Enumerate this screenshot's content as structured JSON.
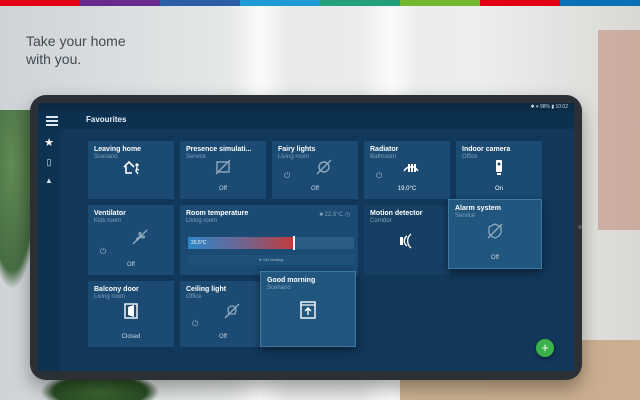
{
  "brand_colors": [
    "#e20015",
    "#6a2a8c",
    "#2a5fa8",
    "#1e9ad6",
    "#21a07a",
    "#74b72e",
    "#e20015",
    "#0a6fb4"
  ],
  "tagline": {
    "line1": "Take your home",
    "line2": "with you."
  },
  "status_bar": {
    "text": "✱ ▾ 98% ▮ 10:02"
  },
  "app_bar": {
    "title": "Favourites",
    "menu_icon": "hamburger-menu-icon"
  },
  "side_nav": [
    {
      "icon": "star-icon",
      "glyph": "★",
      "active": true
    },
    {
      "icon": "tablet-icon",
      "glyph": "▯",
      "active": false
    },
    {
      "icon": "bell-icon",
      "glyph": "▲",
      "active": false
    }
  ],
  "tiles": {
    "leaving_home": {
      "name": "Leaving home",
      "room": "Scenario",
      "icon": "leaving-home-icon"
    },
    "presence": {
      "name": "Presence simulati...",
      "room": "Service",
      "state": "Off",
      "icon": "presence-off-icon"
    },
    "fairy_lights": {
      "name": "Fairy lights",
      "room": "Living room",
      "state": "Off",
      "icon": "plug-off-icon"
    },
    "radiator": {
      "name": "Radiator",
      "room": "Bathroom",
      "state": "19.0°C",
      "icon": "radiator-icon"
    },
    "indoor_camera": {
      "name": "Indoor camera",
      "room": "Office",
      "state": "On",
      "icon": "camera-icon"
    },
    "ventilator": {
      "name": "Ventilator",
      "room": "Kids room",
      "state": "Off",
      "icon": "fan-off-icon"
    },
    "room_temperature": {
      "name": "Room temperature",
      "room": "Living room",
      "current": "20.5°C",
      "target": "22.5°C",
      "fill_fraction": 0.63,
      "action": "Set heating",
      "icon": "thermostat-icon"
    },
    "motion_detector": {
      "name": "Motion detector",
      "room": "Corridor",
      "icon": "motion-icon"
    },
    "alarm_system": {
      "name": "Alarm system",
      "room": "Service",
      "state": "Off",
      "icon": "alarm-off-icon"
    },
    "balcony_door": {
      "name": "Balcony door",
      "room": "Living room",
      "state": "Closed",
      "icon": "door-closed-icon"
    },
    "ceiling_light": {
      "name": "Ceiling light",
      "room": "Office",
      "state": "Off",
      "icon": "light-off-icon"
    },
    "good_morning": {
      "name": "Good morning",
      "room": "Scenario",
      "icon": "blinds-up-icon"
    }
  },
  "fab": {
    "label": "+",
    "icon": "add-icon"
  }
}
